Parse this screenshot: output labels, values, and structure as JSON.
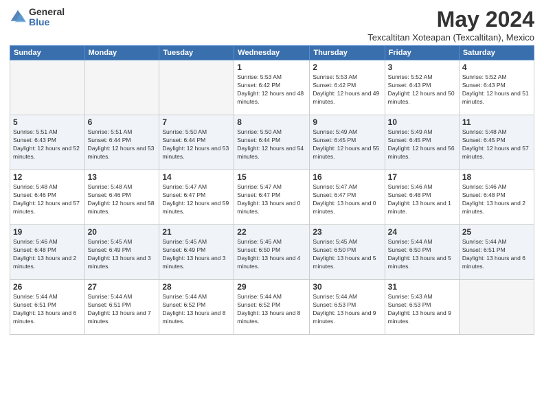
{
  "logo": {
    "general": "General",
    "blue": "Blue"
  },
  "header": {
    "month": "May 2024",
    "location": "Texcaltitan Xoteapan (Texcaltitan), Mexico"
  },
  "weekdays": [
    "Sunday",
    "Monday",
    "Tuesday",
    "Wednesday",
    "Thursday",
    "Friday",
    "Saturday"
  ],
  "weeks": [
    [
      {
        "day": "",
        "sunrise": "",
        "sunset": "",
        "daylight": ""
      },
      {
        "day": "",
        "sunrise": "",
        "sunset": "",
        "daylight": ""
      },
      {
        "day": "",
        "sunrise": "",
        "sunset": "",
        "daylight": ""
      },
      {
        "day": "1",
        "sunrise": "Sunrise: 5:53 AM",
        "sunset": "Sunset: 6:42 PM",
        "daylight": "Daylight: 12 hours and 48 minutes."
      },
      {
        "day": "2",
        "sunrise": "Sunrise: 5:53 AM",
        "sunset": "Sunset: 6:42 PM",
        "daylight": "Daylight: 12 hours and 49 minutes."
      },
      {
        "day": "3",
        "sunrise": "Sunrise: 5:52 AM",
        "sunset": "Sunset: 6:43 PM",
        "daylight": "Daylight: 12 hours and 50 minutes."
      },
      {
        "day": "4",
        "sunrise": "Sunrise: 5:52 AM",
        "sunset": "Sunset: 6:43 PM",
        "daylight": "Daylight: 12 hours and 51 minutes."
      }
    ],
    [
      {
        "day": "5",
        "sunrise": "Sunrise: 5:51 AM",
        "sunset": "Sunset: 6:43 PM",
        "daylight": "Daylight: 12 hours and 52 minutes."
      },
      {
        "day": "6",
        "sunrise": "Sunrise: 5:51 AM",
        "sunset": "Sunset: 6:44 PM",
        "daylight": "Daylight: 12 hours and 53 minutes."
      },
      {
        "day": "7",
        "sunrise": "Sunrise: 5:50 AM",
        "sunset": "Sunset: 6:44 PM",
        "daylight": "Daylight: 12 hours and 53 minutes."
      },
      {
        "day": "8",
        "sunrise": "Sunrise: 5:50 AM",
        "sunset": "Sunset: 6:44 PM",
        "daylight": "Daylight: 12 hours and 54 minutes."
      },
      {
        "day": "9",
        "sunrise": "Sunrise: 5:49 AM",
        "sunset": "Sunset: 6:45 PM",
        "daylight": "Daylight: 12 hours and 55 minutes."
      },
      {
        "day": "10",
        "sunrise": "Sunrise: 5:49 AM",
        "sunset": "Sunset: 6:45 PM",
        "daylight": "Daylight: 12 hours and 56 minutes."
      },
      {
        "day": "11",
        "sunrise": "Sunrise: 5:48 AM",
        "sunset": "Sunset: 6:45 PM",
        "daylight": "Daylight: 12 hours and 57 minutes."
      }
    ],
    [
      {
        "day": "12",
        "sunrise": "Sunrise: 5:48 AM",
        "sunset": "Sunset: 6:46 PM",
        "daylight": "Daylight: 12 hours and 57 minutes."
      },
      {
        "day": "13",
        "sunrise": "Sunrise: 5:48 AM",
        "sunset": "Sunset: 6:46 PM",
        "daylight": "Daylight: 12 hours and 58 minutes."
      },
      {
        "day": "14",
        "sunrise": "Sunrise: 5:47 AM",
        "sunset": "Sunset: 6:47 PM",
        "daylight": "Daylight: 12 hours and 59 minutes."
      },
      {
        "day": "15",
        "sunrise": "Sunrise: 5:47 AM",
        "sunset": "Sunset: 6:47 PM",
        "daylight": "Daylight: 13 hours and 0 minutes."
      },
      {
        "day": "16",
        "sunrise": "Sunrise: 5:47 AM",
        "sunset": "Sunset: 6:47 PM",
        "daylight": "Daylight: 13 hours and 0 minutes."
      },
      {
        "day": "17",
        "sunrise": "Sunrise: 5:46 AM",
        "sunset": "Sunset: 6:48 PM",
        "daylight": "Daylight: 13 hours and 1 minute."
      },
      {
        "day": "18",
        "sunrise": "Sunrise: 5:46 AM",
        "sunset": "Sunset: 6:48 PM",
        "daylight": "Daylight: 13 hours and 2 minutes."
      }
    ],
    [
      {
        "day": "19",
        "sunrise": "Sunrise: 5:46 AM",
        "sunset": "Sunset: 6:48 PM",
        "daylight": "Daylight: 13 hours and 2 minutes."
      },
      {
        "day": "20",
        "sunrise": "Sunrise: 5:45 AM",
        "sunset": "Sunset: 6:49 PM",
        "daylight": "Daylight: 13 hours and 3 minutes."
      },
      {
        "day": "21",
        "sunrise": "Sunrise: 5:45 AM",
        "sunset": "Sunset: 6:49 PM",
        "daylight": "Daylight: 13 hours and 3 minutes."
      },
      {
        "day": "22",
        "sunrise": "Sunrise: 5:45 AM",
        "sunset": "Sunset: 6:50 PM",
        "daylight": "Daylight: 13 hours and 4 minutes."
      },
      {
        "day": "23",
        "sunrise": "Sunrise: 5:45 AM",
        "sunset": "Sunset: 6:50 PM",
        "daylight": "Daylight: 13 hours and 5 minutes."
      },
      {
        "day": "24",
        "sunrise": "Sunrise: 5:44 AM",
        "sunset": "Sunset: 6:50 PM",
        "daylight": "Daylight: 13 hours and 5 minutes."
      },
      {
        "day": "25",
        "sunrise": "Sunrise: 5:44 AM",
        "sunset": "Sunset: 6:51 PM",
        "daylight": "Daylight: 13 hours and 6 minutes."
      }
    ],
    [
      {
        "day": "26",
        "sunrise": "Sunrise: 5:44 AM",
        "sunset": "Sunset: 6:51 PM",
        "daylight": "Daylight: 13 hours and 6 minutes."
      },
      {
        "day": "27",
        "sunrise": "Sunrise: 5:44 AM",
        "sunset": "Sunset: 6:51 PM",
        "daylight": "Daylight: 13 hours and 7 minutes."
      },
      {
        "day": "28",
        "sunrise": "Sunrise: 5:44 AM",
        "sunset": "Sunset: 6:52 PM",
        "daylight": "Daylight: 13 hours and 8 minutes."
      },
      {
        "day": "29",
        "sunrise": "Sunrise: 5:44 AM",
        "sunset": "Sunset: 6:52 PM",
        "daylight": "Daylight: 13 hours and 8 minutes."
      },
      {
        "day": "30",
        "sunrise": "Sunrise: 5:44 AM",
        "sunset": "Sunset: 6:53 PM",
        "daylight": "Daylight: 13 hours and 9 minutes."
      },
      {
        "day": "31",
        "sunrise": "Sunrise: 5:43 AM",
        "sunset": "Sunset: 6:53 PM",
        "daylight": "Daylight: 13 hours and 9 minutes."
      },
      {
        "day": "",
        "sunrise": "",
        "sunset": "",
        "daylight": ""
      }
    ]
  ]
}
